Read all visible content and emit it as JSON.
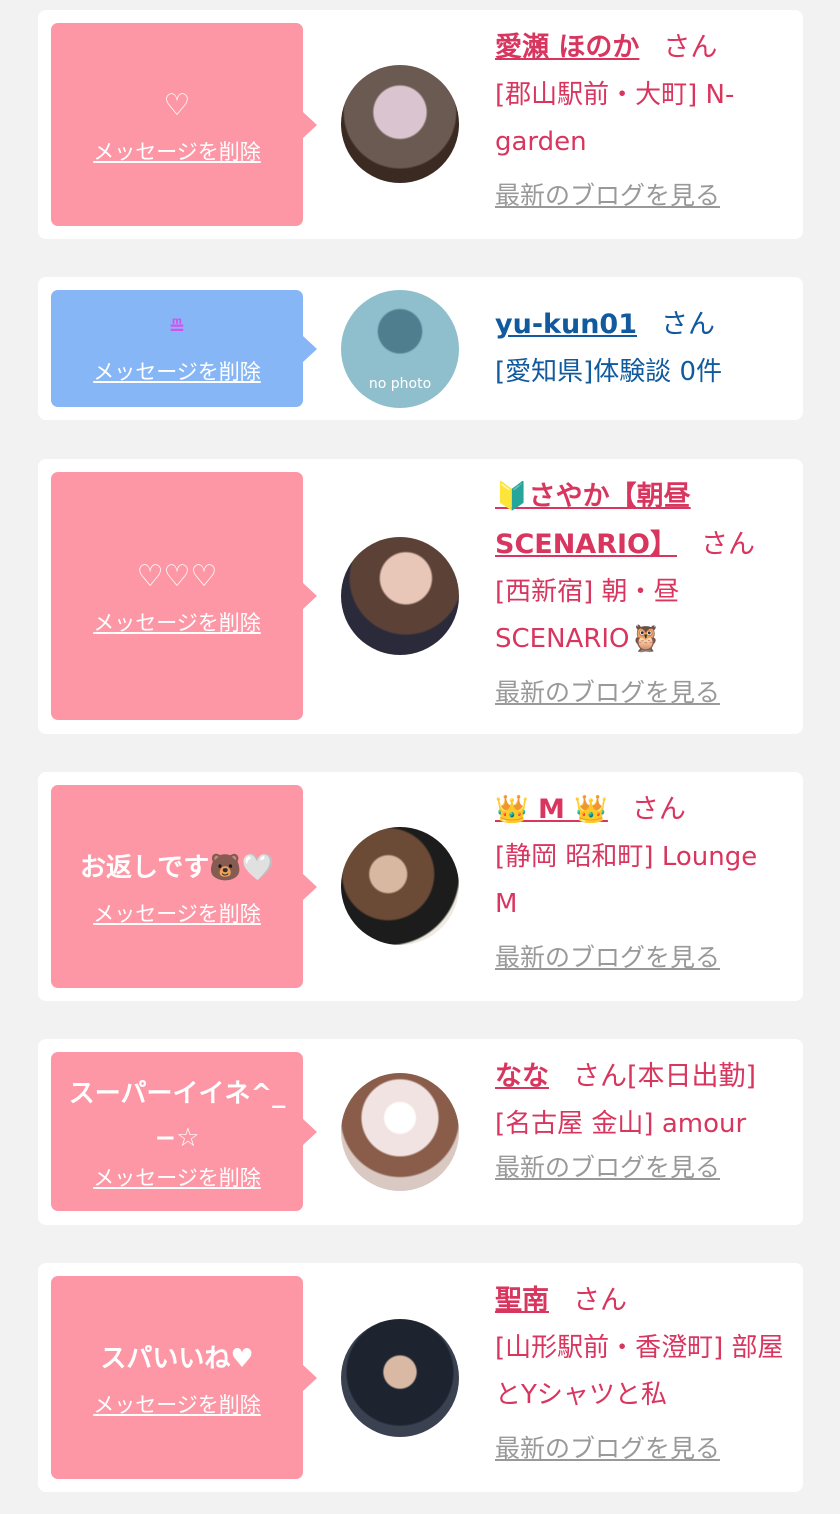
{
  "delete_label": "メッセージを削除",
  "blog_label": "最新のブログを見る",
  "san_label": "さん",
  "cards": [
    {
      "message": "♡",
      "name": "愛瀬 ほのか",
      "san": "さん",
      "shop": "[郡山駅前・大町] N-garden",
      "blog": "最新のブログを見る",
      "bubble_color": "#fd97a5",
      "avatar": "photo-avatar"
    },
    {
      "message": "≞",
      "name": "yu-kun01",
      "san": "さん",
      "shop": "[愛知県]体験談 0件",
      "bubble_color": "#87b6f6",
      "avatar": "no-photo-avatar",
      "avatar_text": "no photo"
    },
    {
      "message": "♡♡♡",
      "name": "🔰さやか【朝昼SCENARIO】",
      "san": "さん",
      "shop": "[西新宿] 朝・昼SCENARIO🦉",
      "blog": "最新のブログを見る",
      "bubble_color": "#fd97a5",
      "avatar": "photo-avatar"
    },
    {
      "message": "お返しです🐻🤍",
      "name": "👑 M 👑",
      "san": "さん",
      "shop": "[静岡 昭和町] Lounge M",
      "blog": "最新のブログを見る",
      "bubble_color": "#fd97a5",
      "avatar": "photo-avatar"
    },
    {
      "message": "スーパーイイネ^_−☆",
      "name": "なな",
      "san": "さん[本日出勤]",
      "shop": "[名古屋 金山] amour",
      "blog": "最新のブログを見る",
      "bubble_color": "#fd97a5",
      "avatar": "photo-avatar"
    },
    {
      "message": "スパいいね♥",
      "name": "聖南",
      "san": "さん",
      "shop": "[山形駅前・香澄町] 部屋とYシャツと私",
      "blog": "最新のブログを見る",
      "bubble_color": "#fd97a5",
      "avatar": "photo-avatar"
    }
  ]
}
